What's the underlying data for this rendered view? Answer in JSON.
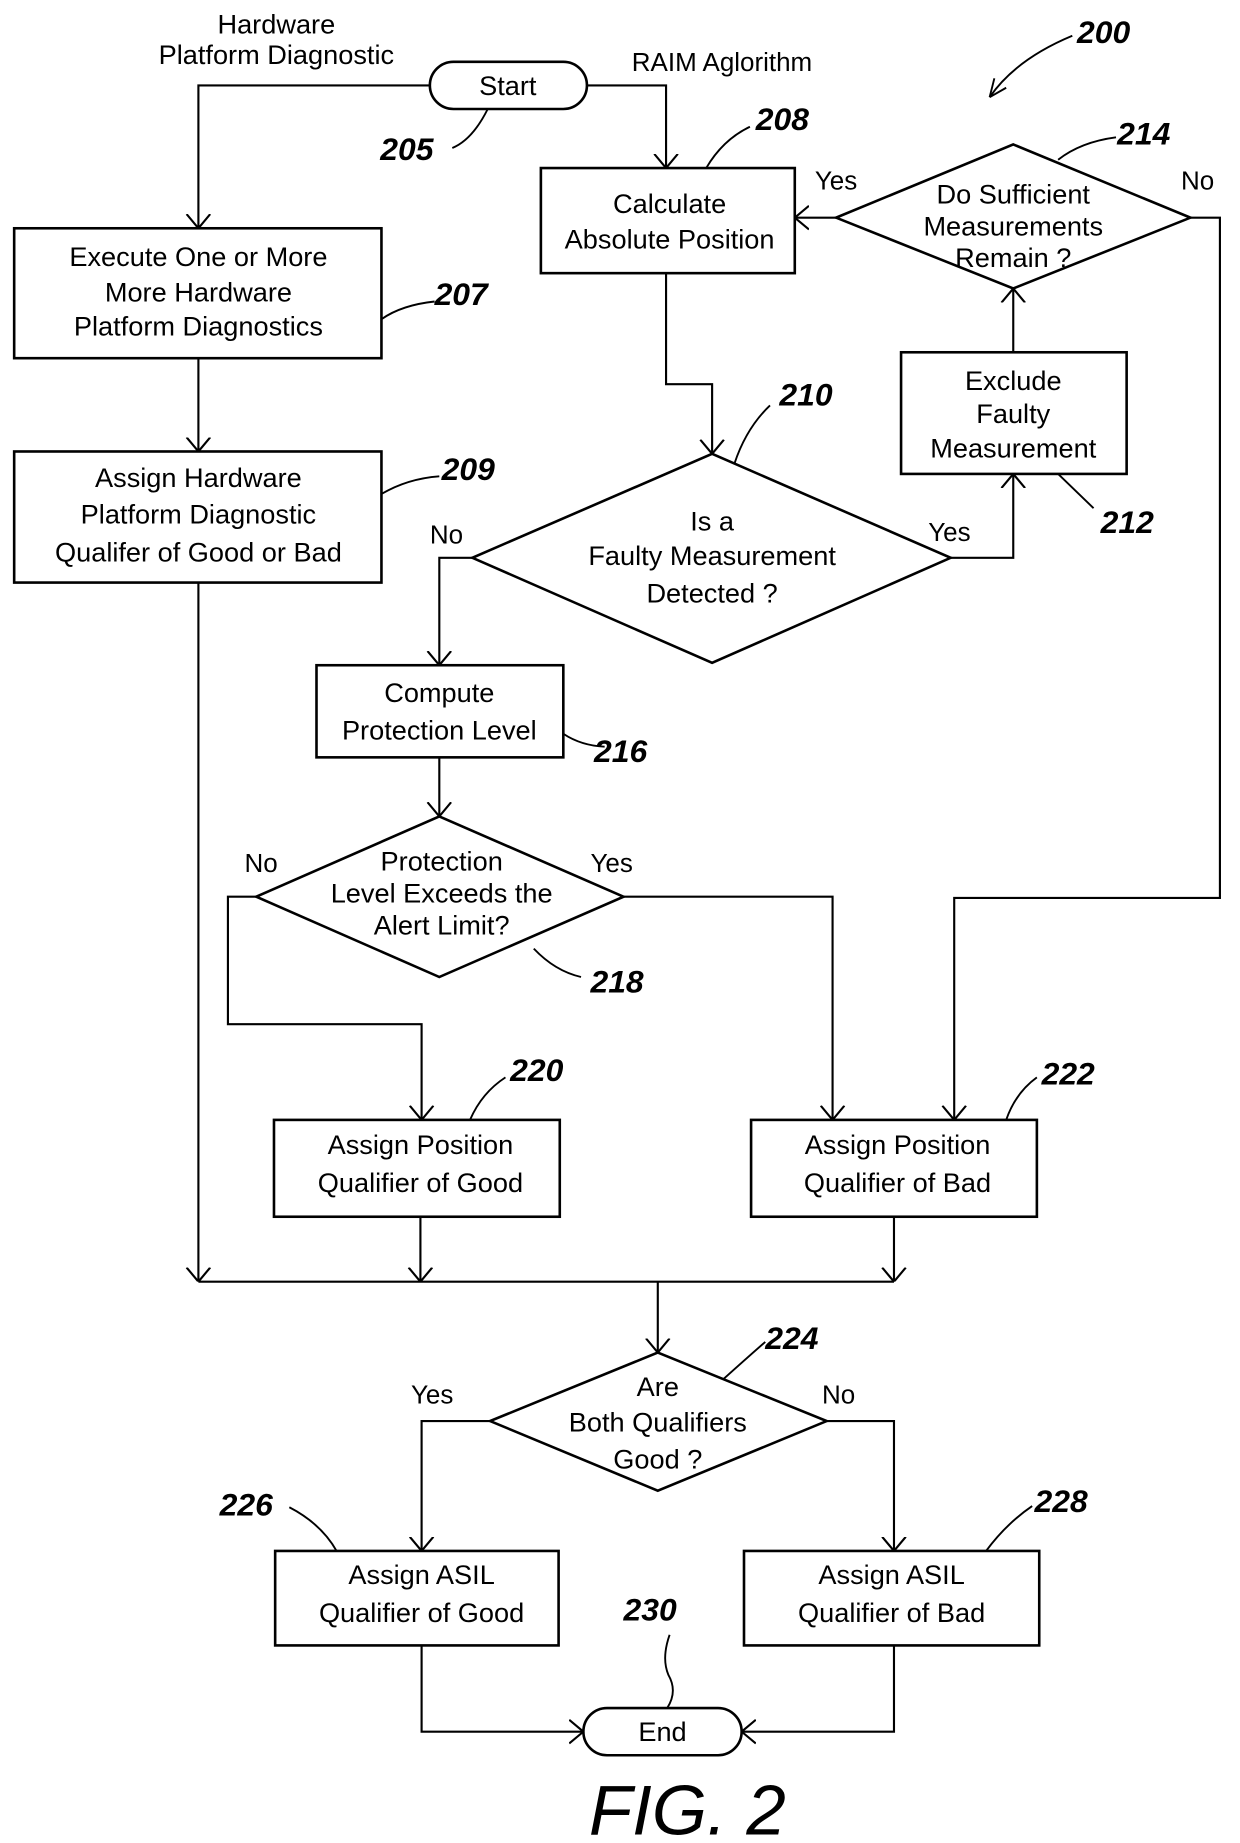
{
  "figure": {
    "caption": "FIG. 2",
    "reference": "200"
  },
  "branches": {
    "left_title_line1": "Hardware",
    "left_title_line2": "Platform Diagnostic",
    "right_title": "RAIM Aglorithm"
  },
  "nodes": {
    "start": {
      "label": "Start",
      "ref": "205"
    },
    "execute_diagnostics": {
      "lines": [
        "Execute One or  More",
        "More Hardware",
        "Platform Diagnostics"
      ],
      "ref": "207"
    },
    "assign_hw_qualifier": {
      "lines": [
        "Assign Hardware",
        "Platform Diagnostic",
        "Qualifer of Good or Bad"
      ],
      "ref": "209"
    },
    "calc_position": {
      "lines": [
        "Calculate",
        "Absolute Position"
      ],
      "ref": "208"
    },
    "faulty_detected": {
      "lines": [
        "Is a",
        "Faulty Measurement",
        "Detected ?"
      ],
      "ref": "210"
    },
    "exclude_faulty": {
      "lines": [
        "Exclude",
        "Faulty",
        "Measurement"
      ],
      "ref": "212"
    },
    "sufficient_remain": {
      "lines": [
        "Do Sufficient",
        "Measurements",
        "Remain ?"
      ],
      "ref": "214"
    },
    "compute_protection": {
      "lines": [
        "Compute",
        "Protection Level"
      ],
      "ref": "216"
    },
    "exceeds_alert": {
      "lines": [
        "Protection",
        "Level Exceeds the",
        "Alert Limit?"
      ],
      "ref": "218"
    },
    "pos_good": {
      "lines": [
        "Assign Position",
        "Qualifier of Good"
      ],
      "ref": "220"
    },
    "pos_bad": {
      "lines": [
        "Assign Position",
        "Qualifier of Bad"
      ],
      "ref": "222"
    },
    "both_good": {
      "lines": [
        "Are",
        "Both Qualifiers",
        "Good ?"
      ],
      "ref": "224"
    },
    "asil_good": {
      "lines": [
        "Assign ASIL",
        "Qualifier of Good"
      ],
      "ref": "226"
    },
    "asil_bad": {
      "lines": [
        "Assign ASIL",
        "Qualifier of Bad"
      ],
      "ref": "228"
    },
    "end": {
      "label": "End",
      "ref": "230"
    }
  },
  "edge_labels": {
    "yes": "Yes",
    "no": "No"
  }
}
